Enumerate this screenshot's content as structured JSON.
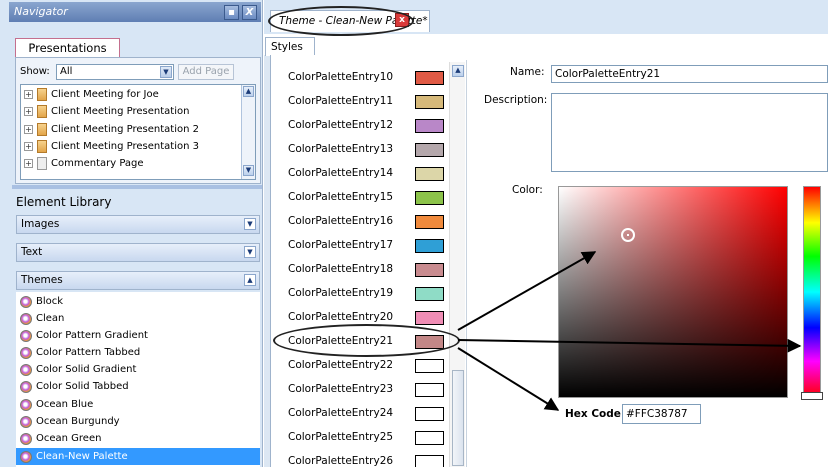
{
  "navigator": {
    "title": "Navigator",
    "pin_icon": "pin-icon",
    "close_label": "X",
    "presentations_tab": "Presentations",
    "show_label": "Show:",
    "show_value": "All",
    "add_page": "Add Page",
    "presentations": [
      "Client Meeting for Joe",
      "Client Meeting Presentation",
      "Client Meeting Presentation 2",
      "Client Meeting Presentation 3",
      "Commentary Page"
    ]
  },
  "library": {
    "title": "Element Library",
    "sections": [
      "Images",
      "Text",
      "Themes"
    ],
    "themes": [
      "Block",
      "Clean",
      "Color Pattern Gradient",
      "Color Pattern Tabbed",
      "Color Solid Gradient",
      "Color Solid Tabbed",
      "Ocean Blue",
      "Ocean Burgundy",
      "Ocean Green",
      "Clean-New Palette"
    ],
    "selected_theme": "Clean-New Palette"
  },
  "document_tab": {
    "title": "Theme - Clean-New Palette*",
    "close_label": "x"
  },
  "styles_tab": "Styles",
  "palette_entries": [
    {
      "name": "ColorPaletteEntry10",
      "color": "#e05a45"
    },
    {
      "name": "ColorPaletteEntry11",
      "color": "#d6b97a"
    },
    {
      "name": "ColorPaletteEntry12",
      "color": "#b987c8"
    },
    {
      "name": "ColorPaletteEntry13",
      "color": "#b4a7ab"
    },
    {
      "name": "ColorPaletteEntry14",
      "color": "#dcd6a8"
    },
    {
      "name": "ColorPaletteEntry15",
      "color": "#8cc34a"
    },
    {
      "name": "ColorPaletteEntry16",
      "color": "#f08a3c"
    },
    {
      "name": "ColorPaletteEntry17",
      "color": "#2f9fd6"
    },
    {
      "name": "ColorPaletteEntry18",
      "color": "#c98b8f"
    },
    {
      "name": "ColorPaletteEntry19",
      "color": "#8fdcc6"
    },
    {
      "name": "ColorPaletteEntry20",
      "color": "#f08db5"
    },
    {
      "name": "ColorPaletteEntry21",
      "color": "#c38787"
    },
    {
      "name": "ColorPaletteEntry22",
      "color": "#ffffff"
    },
    {
      "name": "ColorPaletteEntry23",
      "color": "#ffffff"
    },
    {
      "name": "ColorPaletteEntry24",
      "color": "#ffffff"
    },
    {
      "name": "ColorPaletteEntry25",
      "color": "#ffffff"
    },
    {
      "name": "ColorPaletteEntry26",
      "color": "#ffffff"
    }
  ],
  "selected_entry": "ColorPaletteEntry21",
  "properties": {
    "name_label": "Name:",
    "name_value": "ColorPaletteEntry21",
    "description_label": "Description:",
    "description_value": "",
    "color_label": "Color:",
    "hex_label": "Hex Code:",
    "hex_value": "#FFC38787"
  }
}
